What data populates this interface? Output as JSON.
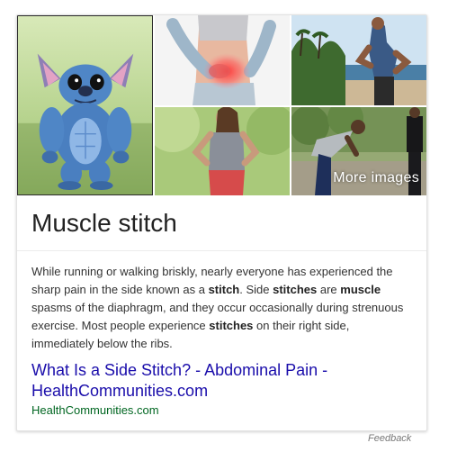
{
  "images": {
    "main_alt": "Stitch cartoon character",
    "waist_alt": "Person holding side with red pain area",
    "beach_alt": "Runner holding side near beach",
    "woman_alt": "Woman holding side",
    "park_alt": "Runner bending over in park",
    "more_images_label": "More images"
  },
  "card": {
    "title": "Muscle stitch",
    "description_parts": [
      {
        "text": "While running or walking briskly, nearly everyone has experienced the sharp pain in the side known as a ",
        "bold": false
      },
      {
        "text": "stitch",
        "bold": true
      },
      {
        "text": ". Side ",
        "bold": false
      },
      {
        "text": "stitches",
        "bold": true
      },
      {
        "text": " are ",
        "bold": false
      },
      {
        "text": "muscle",
        "bold": true
      },
      {
        "text": " spasms of the diaphragm, and they occur occasionally during strenuous exercise. Most people experience ",
        "bold": false
      },
      {
        "text": "stitches",
        "bold": true
      },
      {
        "text": " on their right side, immediately below the ribs.",
        "bold": false
      }
    ],
    "source_title": "What Is a Side Stitch? - Abdominal Pain - HealthCommunities.com",
    "source_url": "HealthCommunities.com"
  },
  "feedback_label": "Feedback",
  "colors": {
    "link": "#1a0dab",
    "url": "#006621",
    "stitch_blue": "#4f86c6",
    "pain_red": "#e53a3a"
  }
}
